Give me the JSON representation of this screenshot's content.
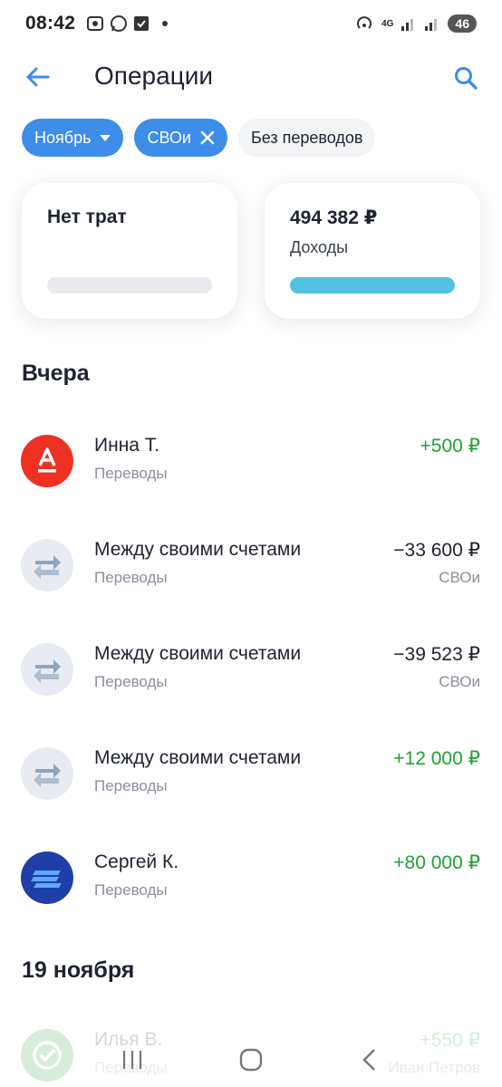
{
  "status_bar": {
    "time": "08:42",
    "network": "4G",
    "battery": "46"
  },
  "header": {
    "title": "Операции"
  },
  "filters": [
    {
      "label": "Ноябрь",
      "active": true
    },
    {
      "label": "СВОи",
      "active": true
    },
    {
      "label": "Без переводов",
      "active": false
    }
  ],
  "summary": {
    "spending": {
      "title": "Нет трат"
    },
    "income": {
      "amount": "494 382 ₽",
      "label": "Доходы",
      "fill": 1.0
    }
  },
  "sections": [
    {
      "title": "Вчера",
      "operations": [
        {
          "name": "Инна Т.",
          "category": "Переводы",
          "amount": "+500 ₽",
          "account": "",
          "icon": "alfa-bank-icon",
          "positive": true
        },
        {
          "name": "Между своими счетами",
          "category": "Переводы",
          "amount": "−33 600 ₽",
          "account": "СВОи",
          "icon": "transfer-arrows-icon",
          "positive": false
        },
        {
          "name": "Между своими счетами",
          "category": "Переводы",
          "amount": "−39 523 ₽",
          "account": "СВОи",
          "icon": "transfer-arrows-icon",
          "positive": false
        },
        {
          "name": "Между своими счетами",
          "category": "Переводы",
          "amount": "+12 000 ₽",
          "account": "",
          "icon": "transfer-arrows-icon",
          "positive": true
        },
        {
          "name": "Сергей К.",
          "category": "Переводы",
          "amount": "+80 000 ₽",
          "account": "",
          "icon": "bank-stripes-icon",
          "positive": true
        }
      ]
    },
    {
      "title": "19 ноября",
      "operations": [
        {
          "name": "Илья В.",
          "category": "Переводы",
          "amount": "+550 ₽",
          "account": "Иван Петров",
          "icon": "sber-bank-icon",
          "positive": true
        }
      ]
    }
  ],
  "colors": {
    "accent": "#3d8de9",
    "positive": "#21a038",
    "income_bar": "#52c0df",
    "alfa_red": "#ef3124",
    "bank_blue": "#1e3fa8"
  }
}
